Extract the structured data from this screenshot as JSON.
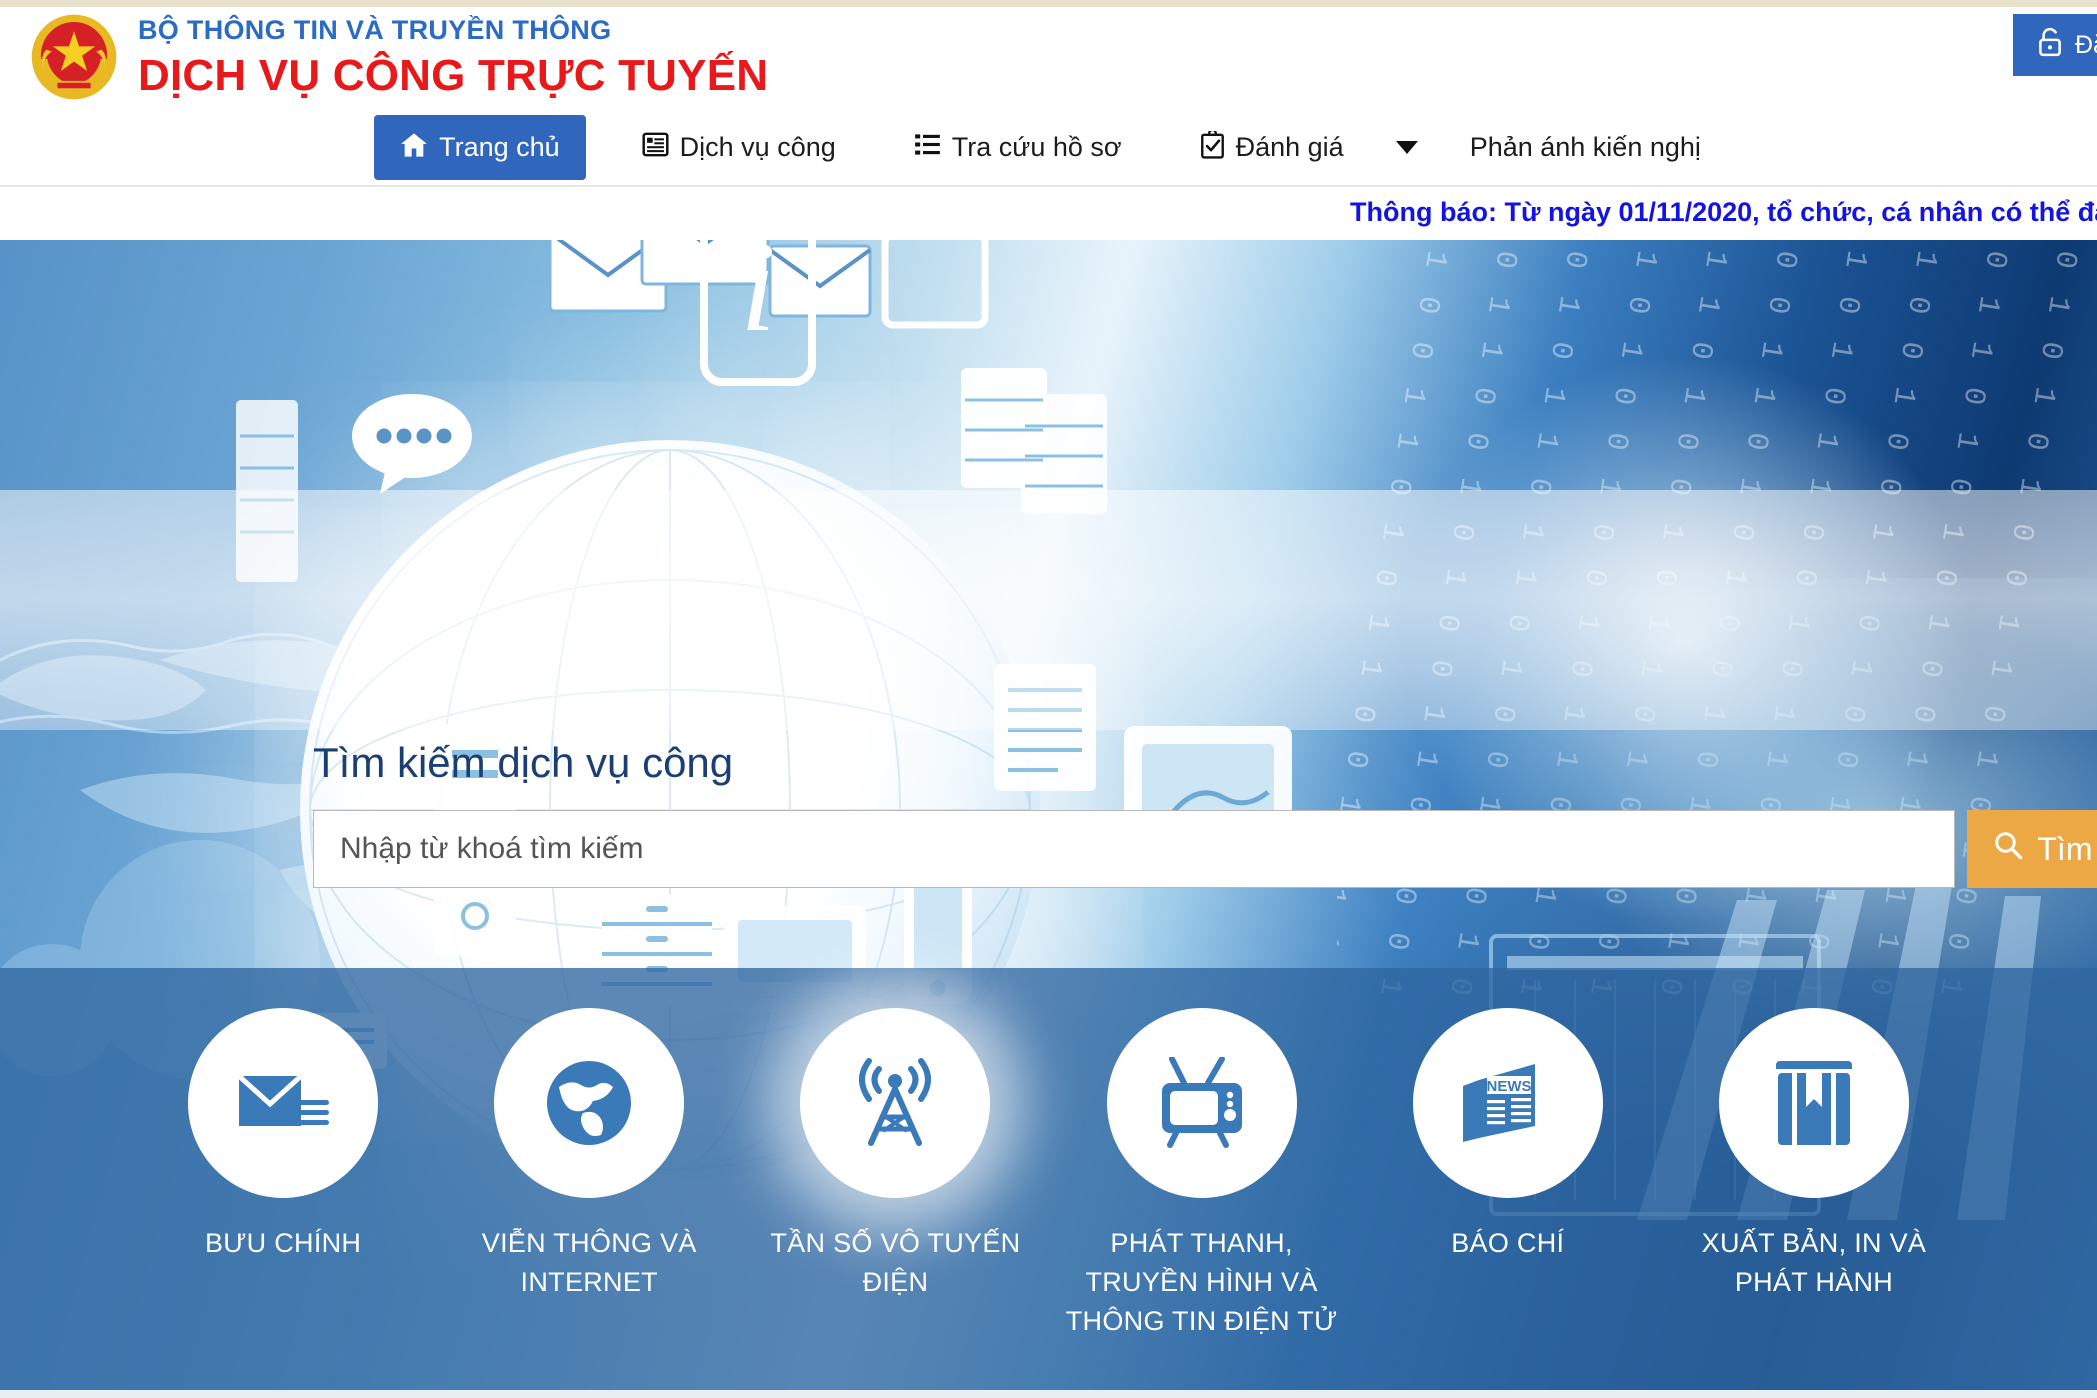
{
  "header": {
    "ministry_name": "BỘ THÔNG TIN VÀ TRUYỀN THÔNG",
    "portal_title": "DỊCH VỤ CÔNG TRỰC TUYẾN",
    "emblem_alt": "Quốc huy Việt Nam",
    "login_label": "Đăng nhập",
    "colors": {
      "ministry_blue": "#2b6bc4",
      "title_red": "#e8191b",
      "nav_active_blue": "#3067bd",
      "search_button_orange": "#eda846",
      "notice_blue": "#1414e0",
      "category_overlay_blue": "#2f67a0"
    }
  },
  "nav": {
    "items": [
      {
        "label": "Trang chủ",
        "icon": "home-icon",
        "active": true
      },
      {
        "label": "Dịch vụ công",
        "icon": "list-document-icon",
        "active": false
      },
      {
        "label": "Tra cứu hồ sơ",
        "icon": "list-icon",
        "active": false
      },
      {
        "label": "Đánh giá",
        "icon": "clipboard-check-icon",
        "active": false,
        "has_dropdown": true
      },
      {
        "label": "Phản ánh kiến nghị",
        "icon": "none",
        "active": false
      }
    ]
  },
  "notice": {
    "text": "Thông báo: Từ ngày 01/11/2020, tổ chức, cá nhân có thể đă"
  },
  "hero": {
    "search_title": "Tìm kiếm dịch vụ công",
    "search_placeholder": "Nhập từ khoá tìm kiếm",
    "search_value": "",
    "search_button_label": "Tìm kiếm"
  },
  "categories": [
    {
      "label": "BƯU CHÍNH",
      "icon": "envelope-mail-icon",
      "highlight": false
    },
    {
      "label": "VIỄN THÔNG VÀ INTERNET",
      "icon": "globe-icon",
      "highlight": false
    },
    {
      "label": "TẦN SỐ VÔ TUYẾN ĐIỆN",
      "icon": "radio-tower-icon",
      "highlight": true
    },
    {
      "label": "PHÁT THANH, TRUYỀN HÌNH VÀ THÔNG TIN ĐIỆN TỬ",
      "icon": "television-icon",
      "highlight": false
    },
    {
      "label": "BÁO CHÍ",
      "icon": "newspaper-icon",
      "highlight": false
    },
    {
      "label": "XUẤT BẢN, IN VÀ PHÁT HÀNH",
      "icon": "book-bookmark-icon",
      "highlight": false
    }
  ]
}
